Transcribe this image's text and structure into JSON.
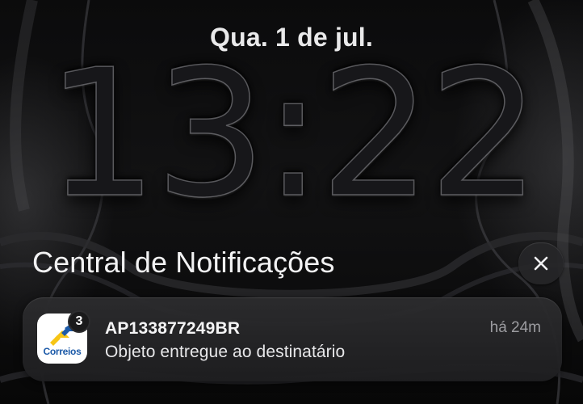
{
  "lockscreen": {
    "date": "Qua. 1 de jul.",
    "time": "13:22"
  },
  "notification_center": {
    "header": "Central de Notificações",
    "close_icon": "close-icon"
  },
  "notifications": [
    {
      "app_name": "Correios",
      "app_icon": "correios-app-icon",
      "badge_count": "3",
      "title": "AP133877249BR",
      "time": "há 24m",
      "body": "Objeto entregue ao destinatário"
    }
  ],
  "colors": {
    "correios_blue": "#1c5aa8",
    "correios_yellow": "#f7c515"
  }
}
